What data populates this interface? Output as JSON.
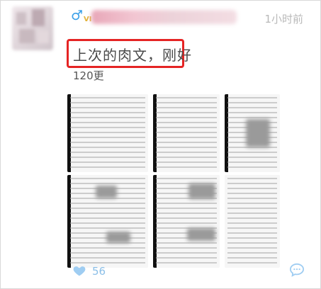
{
  "post": {
    "gender_symbol": "♂",
    "vip_badge": "VI",
    "time": "1小时前",
    "title": "上次的肉文，刚好",
    "subtitle": "120更",
    "likes": "56"
  },
  "colors": {
    "highlight_border": "#e52424",
    "accent": "#3aa0e8",
    "like": "#9fcdf2"
  },
  "icons": {
    "like": "heart-icon",
    "comment": "comment-bubble-icon"
  },
  "images_count": 6
}
